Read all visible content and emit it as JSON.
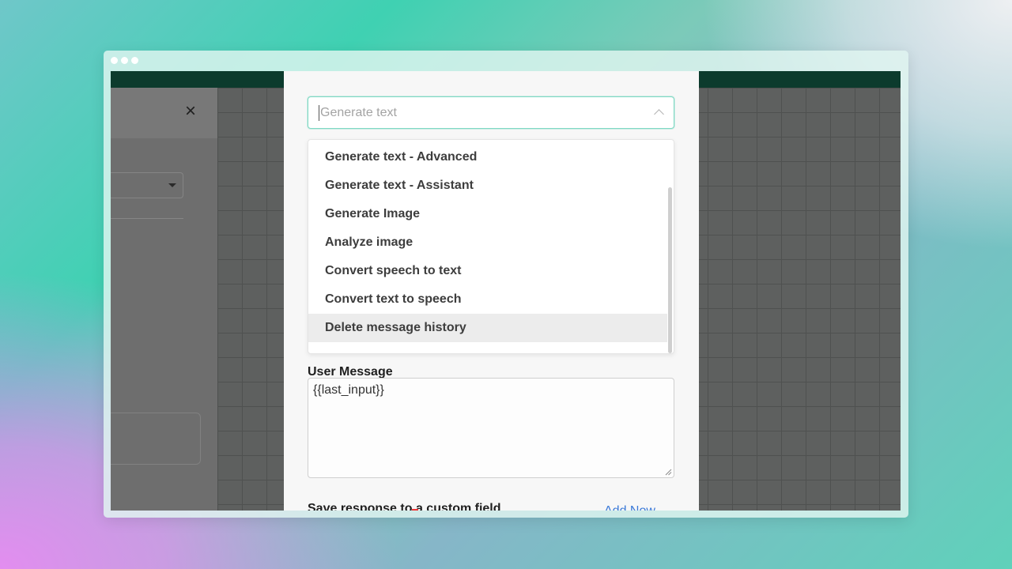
{
  "dropdown": {
    "placeholder": "Generate text",
    "options": [
      "Generate text - Advanced",
      "Generate text - Assistant",
      "Generate Image",
      "Analyze image",
      "Convert speech to text",
      "Convert text to speech",
      "Delete message history"
    ],
    "hovered": "Delete message history"
  },
  "user_message": {
    "label": "User Message",
    "value": "{{last_input}}"
  },
  "save_response": {
    "label": "Save response to a custom field",
    "add_now": "Add Now"
  },
  "colors": {
    "accent_border": "#7fd8c3",
    "topbar": "#0c3b2d",
    "link": "#3b7ad8"
  },
  "icons": [
    "close-icon",
    "chevron-up-icon",
    "caret-down-icon",
    "hand-cursor-icon",
    "resize-grip-icon"
  ]
}
